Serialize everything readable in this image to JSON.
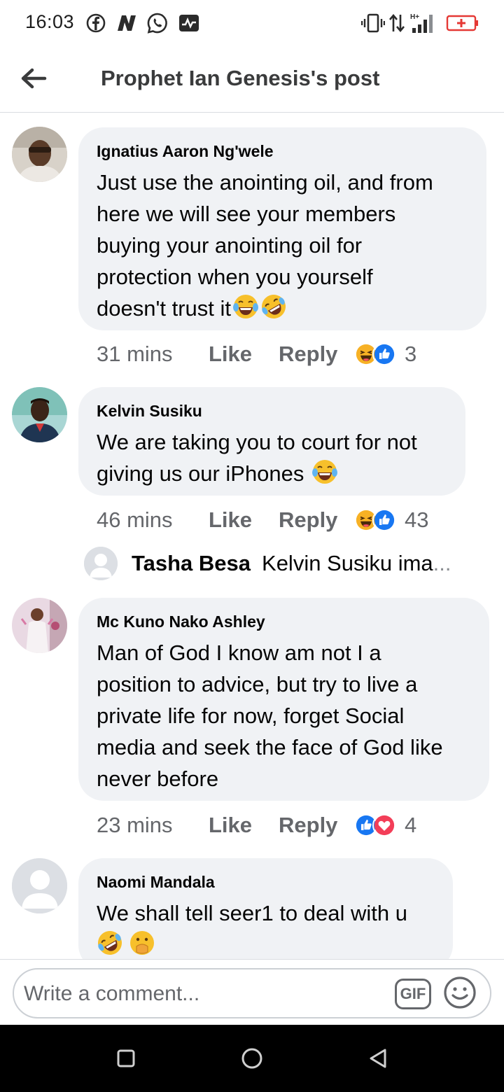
{
  "status_bar": {
    "time": "16:03",
    "left_icons": [
      "facebook-icon",
      "n-app-icon",
      "whatsapp-icon",
      "activity-icon"
    ],
    "right_icons": [
      "vibrate-icon",
      "data-arrows-icon",
      "signal-hplus-icon",
      "battery-low-icon"
    ],
    "network_label": "H+"
  },
  "header": {
    "title": "Prophet Ian Genesis's post",
    "back_icon": "arrow-left-icon"
  },
  "comments": [
    {
      "name": "Ignatius Aaron Ng'wele",
      "text_lines": [
        "Just use the anointing oil, and from",
        "here we will see your members",
        "buying your anointing oil for",
        "protection when you yourself",
        "doesn't trust it"
      ],
      "emojis": [
        "tears-of-joy",
        "rofl"
      ],
      "time": "31 mins",
      "like": "Like",
      "reply": "Reply",
      "reactions": [
        "haha",
        "like"
      ],
      "reaction_count": "3"
    },
    {
      "name": "Kelvin Susiku",
      "text_lines": [
        "We are taking you to court for not",
        "giving us our iPhones "
      ],
      "emojis": [
        "tears-of-joy"
      ],
      "time": "46 mins",
      "like": "Like",
      "reply": "Reply",
      "reactions": [
        "haha",
        "like"
      ],
      "reaction_count": "43"
    },
    {
      "name": "Mc Kuno Nako Ashley",
      "text_lines": [
        "Man of God I know am not I a",
        "position to advice, but try to live a",
        "private life for now, forget Social",
        "media and seek the face of God like",
        "never before"
      ],
      "emojis": [],
      "time": "23 mins",
      "like": "Like",
      "reply": "Reply",
      "reactions": [
        "like",
        "love"
      ],
      "reaction_count": "4"
    },
    {
      "name": "Naomi Mandala",
      "text_lines": [
        "We shall tell seer1 to deal with u"
      ],
      "emojis": [
        "rofl",
        "hand-over-mouth"
      ]
    }
  ],
  "reply_preview": {
    "name": "Tasha Besa",
    "text": "Kelvin Susiku ima",
    "ellipsis": "..."
  },
  "composer": {
    "placeholder": "Write a comment...",
    "gif_label": "GIF",
    "emoji_icon": "smiley-icon"
  },
  "colors": {
    "bubble": "#f0f2f5",
    "like_blue": "#1877f2",
    "haha_yellow": "#f7b125",
    "love_red": "#f33e58",
    "secondary_text": "#65676b"
  },
  "navbar": {
    "buttons": [
      "square-recents-icon",
      "circle-home-icon",
      "triangle-back-icon"
    ]
  }
}
